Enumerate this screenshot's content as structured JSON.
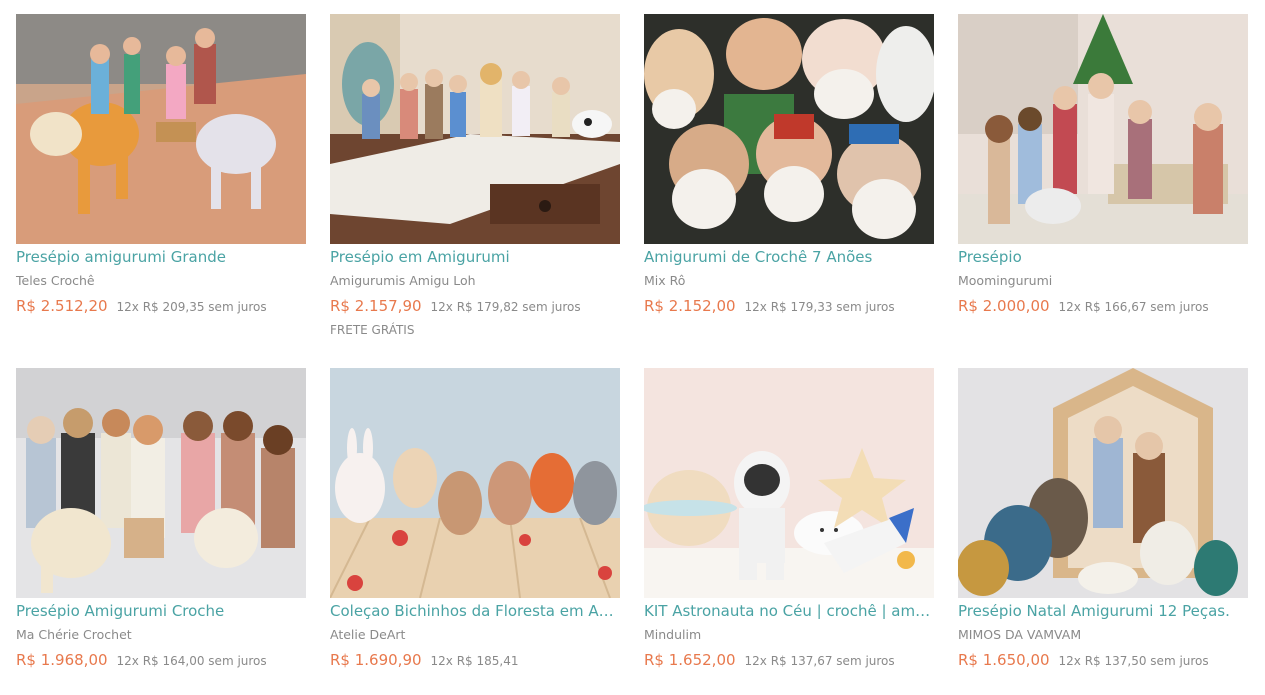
{
  "products": [
    {
      "title": "Presépio amigurumi Grande",
      "shop": "Teles Crochê",
      "price": "R$ 2.512,20",
      "installments": "12x R$ 209,35 sem juros",
      "shipping": "",
      "image_icon": "nativity-amigurumi-photo"
    },
    {
      "title": "Presépio em Amigurumi",
      "shop": "Amigurumis Amigu Loh",
      "price": "R$ 2.157,90",
      "installments": "12x R$ 179,82 sem juros",
      "shipping": "FRETE GRÁTIS",
      "image_icon": "nativity-amigurumi-photo"
    },
    {
      "title": "Amigurumi de Crochê 7 Anões",
      "shop": "Mix Rô",
      "price": "R$ 2.152,00",
      "installments": "12x R$ 179,33 sem juros",
      "shipping": "",
      "image_icon": "dwarves-amigurumi-photo"
    },
    {
      "title": "Presépio",
      "shop": "Moomingurumi",
      "price": "R$ 2.000,00",
      "installments": "12x R$ 166,67 sem juros",
      "shipping": "",
      "image_icon": "nativity-amigurumi-photo"
    },
    {
      "title": "Presépio Amigurumi Croche",
      "shop": "Ma Chérie Crochet",
      "price": "R$ 1.968,00",
      "installments": "12x R$ 164,00 sem juros",
      "shipping": "",
      "image_icon": "nativity-amigurumi-photo"
    },
    {
      "title": "Coleçao Bichinhos da Floresta em Amigurumi",
      "shop": "Atelie DeArt",
      "price": "R$ 1.690,90",
      "installments": "12x R$ 185,41",
      "shipping": "",
      "image_icon": "forest-animals-amigurumi-photo"
    },
    {
      "title": "KIT Astronauta no Céu | crochê | amigurumi",
      "shop": "Mindulim",
      "price": "R$ 1.652,00",
      "installments": "12x R$ 137,67 sem juros",
      "shipping": "",
      "image_icon": "astronaut-kit-amigurumi-photo"
    },
    {
      "title": "Presépio Natal Amigurumi 12 Peças.",
      "shop": "MIMOS DA VAMVAM",
      "price": "R$ 1.650,00",
      "installments": "12x R$ 137,50 sem juros",
      "shipping": "",
      "image_icon": "nativity-amigurumi-photo"
    }
  ],
  "colors": {
    "title": "#4aa3a4",
    "price": "#e8794d",
    "muted": "#8a8a8a"
  }
}
